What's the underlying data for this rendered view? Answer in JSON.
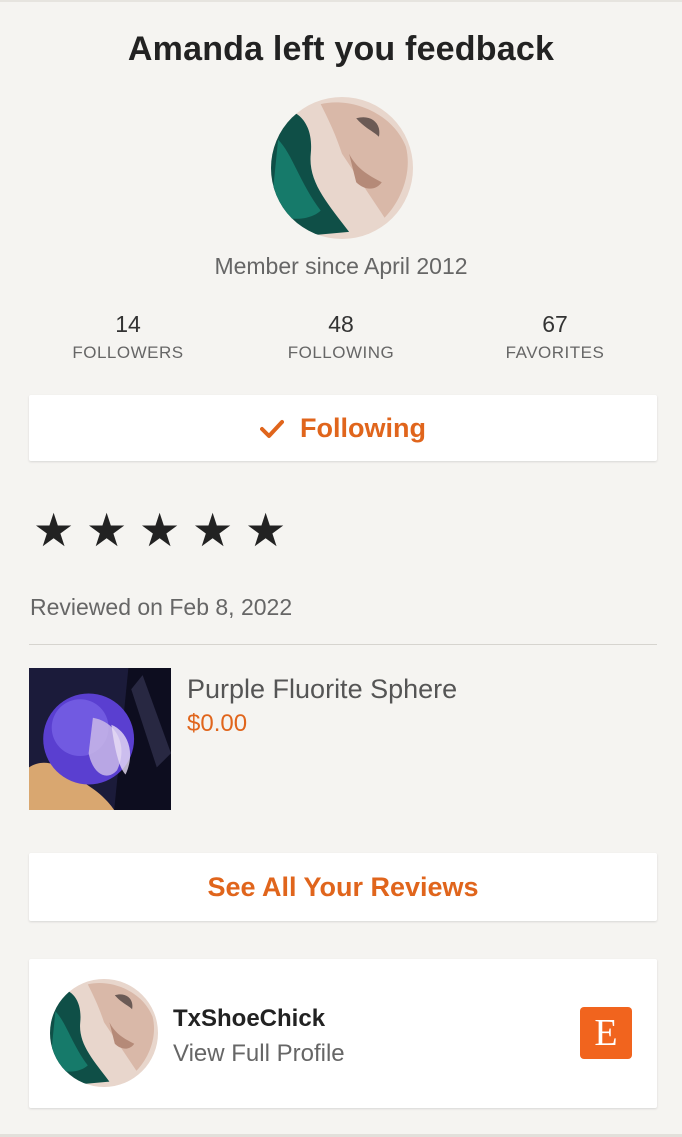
{
  "header": {
    "title": "Amanda left you feedback"
  },
  "profile": {
    "member_since": "Member since April 2012",
    "stats": [
      {
        "value": "14",
        "label": "FOLLOWERS"
      },
      {
        "value": "48",
        "label": "FOLLOWING"
      },
      {
        "value": "67",
        "label": "FAVORITES"
      }
    ],
    "follow_button_label": "Following",
    "follow_icon": "checkmark-icon"
  },
  "review": {
    "rating": 5,
    "max_rating": 5,
    "star_icon": "star-icon",
    "reviewed_on": "Reviewed on Feb 8, 2022",
    "product": {
      "name": "Purple Fluorite Sphere",
      "price": "$0.00"
    }
  },
  "actions": {
    "see_all_reviews_label": "See All Your Reviews"
  },
  "shop": {
    "name": "TxShoeChick",
    "link_label": "View Full Profile",
    "logo_letter": "E",
    "logo_icon": "etsy-logo-icon"
  },
  "colors": {
    "accent": "#e0651c",
    "etsy_orange": "#f1641e",
    "background": "#f5f4f1"
  }
}
